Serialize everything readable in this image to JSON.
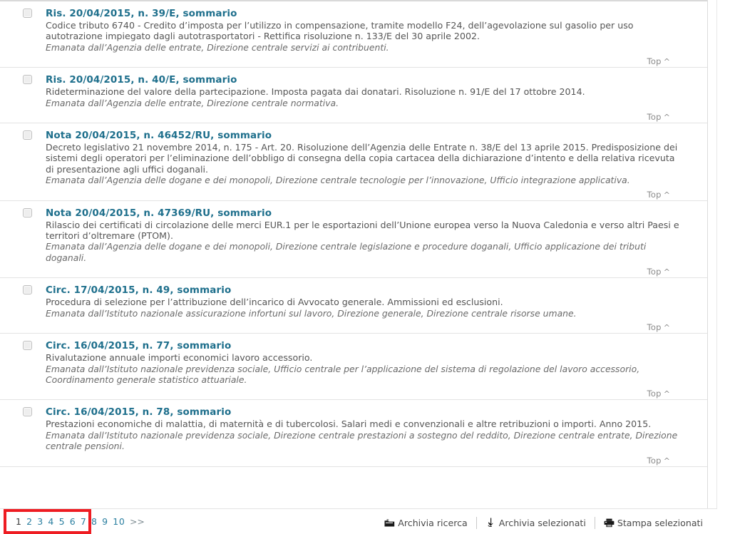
{
  "results": [
    {
      "title": "Ris. 20/04/2015, n. 39/E, sommario",
      "description": "Codice tributo 6740 - Credito d’imposta per l’utilizzo in compensazione, tramite modello F24, dell’agevolazione sul gasolio per uso autotrazione impiegato dagli autotrasportatori - Rettifica risoluzione n. 133/E del 30 aprile 2002.",
      "source": "Emanata dall’Agenzia delle entrate, Direzione centrale servizi ai contribuenti.",
      "top_label": "Top",
      "top_caret": "^"
    },
    {
      "title": "Ris. 20/04/2015, n. 40/E, sommario",
      "description": "Rideterminazione del valore della partecipazione. Imposta pagata dai donatari. Risoluzione n. 91/E del 17 ottobre 2014.",
      "source": "Emanata dall’Agenzia delle entrate, Direzione centrale normativa.",
      "top_label": "Top",
      "top_caret": "^"
    },
    {
      "title": "Nota 20/04/2015, n. 46452/RU, sommario",
      "description": "Decreto legislativo 21 novembre 2014, n. 175 - Art. 20. Risoluzione dell’Agenzia delle Entrate n. 38/E del 13 aprile 2015. Predisposizione dei sistemi degli operatori per l’eliminazione dell’obbligo di consegna della copia cartacea della dichiarazione d’intento e della relativa ricevuta di presentazione agli uffici doganali.",
      "source": "Emanata dall’Agenzia delle dogane e dei monopoli, Direzione centrale tecnologie per l’innovazione, Ufficio integrazione applicativa.",
      "top_label": "Top",
      "top_caret": "^"
    },
    {
      "title": "Nota 20/04/2015, n. 47369/RU, sommario",
      "description": "Rilascio dei certificati di circolazione delle merci EUR.1 per le esportazioni dell’Unione europea verso la Nuova Caledonia e verso altri Paesi e territori d’oltremare (PTOM).",
      "source": "Emanata dall’Agenzia delle dogane e dei monopoli, Direzione centrale legislazione e procedure doganali, Ufficio applicazione dei tributi doganali.",
      "top_label": "Top",
      "top_caret": "^"
    },
    {
      "title": "Circ. 17/04/2015, n. 49, sommario",
      "description": "Procedura di selezione per l’attribuzione dell’incarico di Avvocato generale. Ammissioni ed esclusioni.",
      "source": "Emanata dall’Istituto nazionale assicurazione infortuni sul lavoro, Direzione generale, Direzione centrale risorse umane.",
      "top_label": "Top",
      "top_caret": "^"
    },
    {
      "title": "Circ. 16/04/2015, n. 77, sommario",
      "description": "Rivalutazione annuale importi economici lavoro accessorio.",
      "source": "Emanata dall’Istituto nazionale previdenza sociale, Ufficio centrale per l’applicazione del sistema di regolazione del lavoro accessorio, Coordinamento generale statistico attuariale.",
      "top_label": "Top",
      "top_caret": "^"
    },
    {
      "title": "Circ. 16/04/2015, n. 78, sommario",
      "description": "Prestazioni economiche di malattia, di maternità e di tubercolosi. Salari medi e convenzionali e altre retribuzioni o importi. Anno 2015.",
      "source": "Emanata dall’Istituto nazionale previdenza sociale, Direzione centrale prestazioni a sostegno del reddito, Direzione centrale entrate, Direzione centrale pensioni.",
      "top_label": "Top",
      "top_caret": "^"
    }
  ],
  "footer": {
    "pagination": {
      "current_page": "1",
      "pages": [
        "2",
        "3",
        "4",
        "5",
        "6",
        "7",
        "8",
        "9",
        "10"
      ],
      "next_label": ">>"
    },
    "actions": [
      {
        "label": "Archivia ricerca",
        "icon": "folder-archive-icon"
      },
      {
        "label": "Archivia selezionati",
        "icon": "archive-down-arrow-icon"
      },
      {
        "label": "Stampa selezionati",
        "icon": "printer-icon"
      }
    ]
  },
  "colors": {
    "title_link": "#1e6f8c",
    "pagination_link": "#2b7fa0",
    "annotation": "#ee1c22",
    "body_text": "#555555",
    "source_text": "#6a6a6a",
    "divider": "#e3e3e3"
  }
}
